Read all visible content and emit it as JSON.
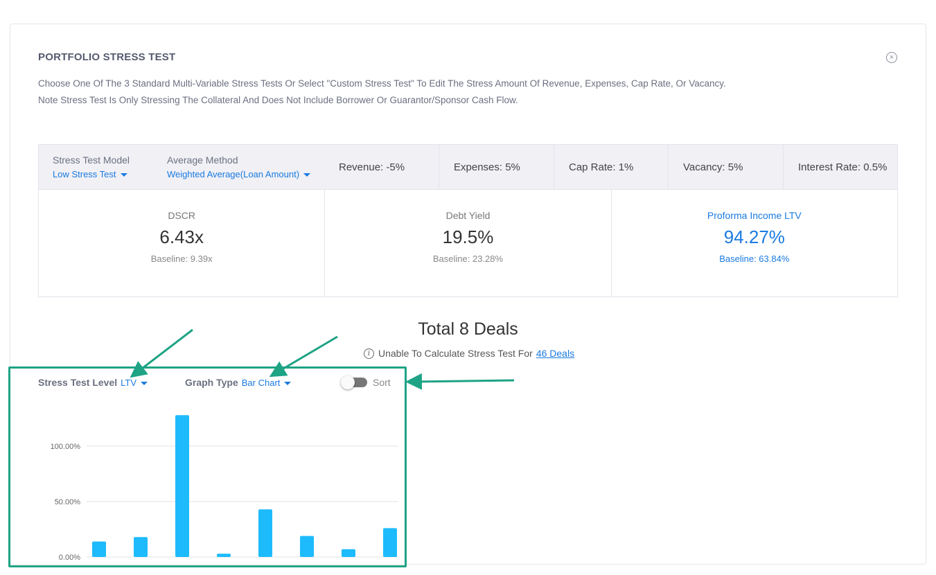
{
  "header": {
    "title": "PORTFOLIO STRESS TEST",
    "close_symbol": "×",
    "description_line1": "Choose One Of The 3 Standard Multi-Variable Stress Tests Or Select \"Custom Stress Test\" To Edit The Stress Amount Of Revenue, Expenses, Cap Rate, Or Vacancy.",
    "description_line2": "Note Stress Test Is Only Stressing The Collateral And Does Not Include Borrower Or Guarantor/Sponsor Cash Flow."
  },
  "settings": {
    "model_label": "Stress Test Model",
    "model_value": "Low Stress Test",
    "method_label": "Average Method",
    "method_value": "Weighted Average(Loan Amount)",
    "params": [
      {
        "label": "Revenue: -5%"
      },
      {
        "label": "Expenses: 5%"
      },
      {
        "label": "Cap Rate: 1%"
      },
      {
        "label": "Vacancy: 5%"
      },
      {
        "label": "Interest Rate: 0.5%"
      }
    ]
  },
  "metrics": [
    {
      "label": "DSCR",
      "value": "6.43x",
      "baseline": "Baseline: 9.39x"
    },
    {
      "label": "Debt Yield",
      "value": "19.5%",
      "baseline": "Baseline: 23.28%"
    },
    {
      "label": "Proforma Income LTV",
      "value": "94.27%",
      "baseline": "Baseline: 63.84%"
    }
  ],
  "summary": {
    "total": "Total 8 Deals",
    "unable_text": "Unable To Calculate Stress Test For",
    "unable_link": "46 Deals",
    "info_symbol": "i"
  },
  "controls": {
    "level_label": "Stress Test Level",
    "level_value": "LTV",
    "graph_label": "Graph Type",
    "graph_value": "Bar Chart",
    "sort_label": "Sort",
    "sort_on": false
  },
  "colors": {
    "accent": "#1a7ae0",
    "bar": "#1ebbfc",
    "highlight": "#1ea385"
  },
  "chart_data": {
    "type": "bar",
    "values": [
      14,
      18,
      128,
      3,
      43,
      19,
      7,
      26
    ],
    "ylim": [
      0,
      140
    ],
    "yticks": [
      0,
      50,
      100
    ],
    "ytick_labels": [
      "0.00%",
      "50.00%",
      "100.00%"
    ],
    "grid": true
  }
}
